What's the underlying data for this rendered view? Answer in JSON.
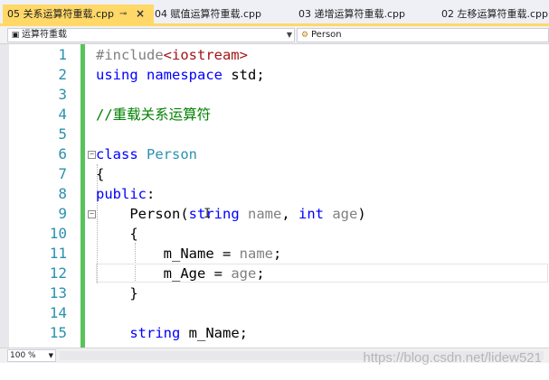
{
  "tabs": [
    {
      "label": "05 关系运算符重载.cpp",
      "active": true,
      "pin_icon": "pin-icon",
      "close_icon": "close-icon"
    },
    {
      "label": "04 赋值运算符重载.cpp",
      "active": false
    },
    {
      "label": "03 递增运算符重载.cpp",
      "active": false
    },
    {
      "label": "02 左移运算符重载.cpp",
      "active": false
    }
  ],
  "nav": {
    "scope_dropdown": "运算符重载",
    "member_dropdown": "Person"
  },
  "editor": {
    "line_numbers": [
      "1",
      "2",
      "3",
      "4",
      "5",
      "6",
      "7",
      "8",
      "9",
      "10",
      "11",
      "12",
      "13",
      "14",
      "15"
    ],
    "lines": [
      "#include<iostream>",
      "using namespace std;",
      "",
      "//重载关系运算符",
      "",
      "class Person",
      "{",
      "public:",
      "    Person(string name, int age)",
      "    {",
      "        m_Name = name;",
      "        m_Age = age;",
      "    }",
      "",
      "    string m_Name;"
    ]
  },
  "status": {
    "zoom": "100 %"
  },
  "watermark": "https://blog.csdn.net/lidew521",
  "colors": {
    "active_tab": "#ffd868",
    "keyword": "#0000ff",
    "type": "#2b91af",
    "comment": "#008000",
    "line_number": "#2b91af",
    "change_bar": "#58c35a"
  }
}
